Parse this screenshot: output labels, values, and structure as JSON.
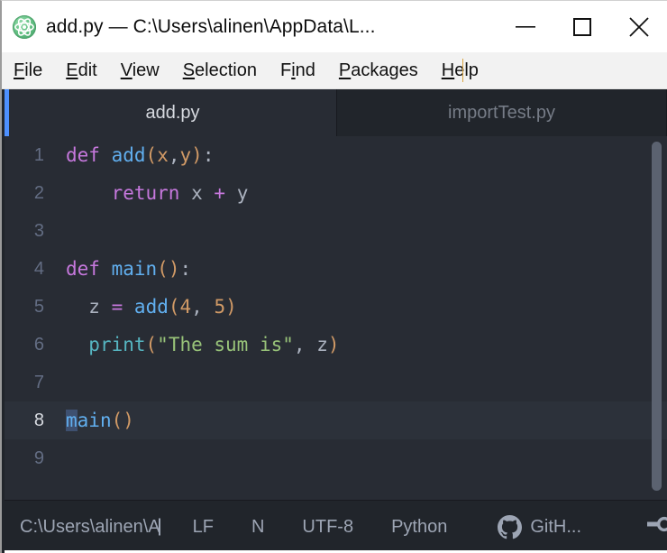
{
  "window": {
    "title": "add.py — C:\\Users\\alinen\\AppData\\L...",
    "app_icon": "atom-icon",
    "controls": {
      "minimize": "minimize-icon",
      "maximize": "maximize-icon",
      "close": "close-icon"
    }
  },
  "menubar": {
    "items": [
      {
        "pre": "",
        "accel": "F",
        "post": "ile"
      },
      {
        "pre": "",
        "accel": "E",
        "post": "dit"
      },
      {
        "pre": "",
        "accel": "V",
        "post": "iew"
      },
      {
        "pre": "",
        "accel": "S",
        "post": "election"
      },
      {
        "pre": "F",
        "accel": "i",
        "post": "nd"
      },
      {
        "pre": "",
        "accel": "P",
        "post": "ackages"
      },
      {
        "pre": "",
        "accel": "H",
        "post": "elp"
      }
    ]
  },
  "tabs": [
    {
      "label": "add.py",
      "active": true
    },
    {
      "label": "importTest.py",
      "active": false
    }
  ],
  "editor": {
    "active_line": 8,
    "selection": "m",
    "lines": [
      {
        "n": "1",
        "tokens": [
          {
            "t": "def",
            "c": "kw"
          },
          {
            "t": " ",
            "c": "punc"
          },
          {
            "t": "add",
            "c": "fn"
          },
          {
            "t": "(",
            "c": "paren"
          },
          {
            "t": "x",
            "c": "param"
          },
          {
            "t": ",",
            "c": "punc"
          },
          {
            "t": "y",
            "c": "param"
          },
          {
            "t": ")",
            "c": "paren"
          },
          {
            "t": ":",
            "c": "punc"
          }
        ]
      },
      {
        "n": "2",
        "tokens": [
          {
            "t": "    ",
            "c": "punc"
          },
          {
            "t": "return",
            "c": "kw"
          },
          {
            "t": " ",
            "c": "punc"
          },
          {
            "t": "x",
            "c": "var"
          },
          {
            "t": " ",
            "c": "punc"
          },
          {
            "t": "+",
            "c": "op"
          },
          {
            "t": " ",
            "c": "punc"
          },
          {
            "t": "y",
            "c": "var"
          }
        ]
      },
      {
        "n": "3",
        "tokens": []
      },
      {
        "n": "4",
        "tokens": [
          {
            "t": "def",
            "c": "kw"
          },
          {
            "t": " ",
            "c": "punc"
          },
          {
            "t": "main",
            "c": "fn"
          },
          {
            "t": "()",
            "c": "paren"
          },
          {
            "t": ":",
            "c": "punc"
          }
        ]
      },
      {
        "n": "5",
        "tokens": [
          {
            "t": "  ",
            "c": "punc"
          },
          {
            "t": "z",
            "c": "var"
          },
          {
            "t": " ",
            "c": "punc"
          },
          {
            "t": "=",
            "c": "op"
          },
          {
            "t": " ",
            "c": "punc"
          },
          {
            "t": "add",
            "c": "fn"
          },
          {
            "t": "(",
            "c": "paren"
          },
          {
            "t": "4",
            "c": "num"
          },
          {
            "t": ",",
            "c": "punc"
          },
          {
            "t": " ",
            "c": "punc"
          },
          {
            "t": "5",
            "c": "num"
          },
          {
            "t": ")",
            "c": "paren"
          }
        ]
      },
      {
        "n": "6",
        "tokens": [
          {
            "t": "  ",
            "c": "punc"
          },
          {
            "t": "print",
            "c": "builtin"
          },
          {
            "t": "(",
            "c": "paren"
          },
          {
            "t": "\"The sum is\"",
            "c": "str"
          },
          {
            "t": ",",
            "c": "punc"
          },
          {
            "t": " ",
            "c": "punc"
          },
          {
            "t": "z",
            "c": "var"
          },
          {
            "t": ")",
            "c": "paren"
          }
        ]
      },
      {
        "n": "7",
        "tokens": []
      },
      {
        "n": "8",
        "tokens": [
          {
            "t": "m",
            "c": "fn sel"
          },
          {
            "t": "ain",
            "c": "fn"
          },
          {
            "t": "()",
            "c": "paren"
          }
        ]
      },
      {
        "n": "9",
        "tokens": []
      }
    ]
  },
  "statusbar": {
    "path": "C:\\Users\\alinen\\A",
    "line_ending": "LF",
    "indent": "N",
    "encoding": "UTF-8",
    "grammar": "Python",
    "github": "GitH...",
    "github_icon": "github-icon",
    "branch_icon": "git-branch-icon"
  },
  "colors": {
    "accent": "#4d90fe",
    "editor_bg": "#282c34",
    "chrome_bg": "#21252b",
    "selection": "#3e5070",
    "keyword": "#c678dd",
    "function": "#61afef",
    "param": "#d19a66",
    "string": "#98c379",
    "builtin": "#56b6c2"
  }
}
